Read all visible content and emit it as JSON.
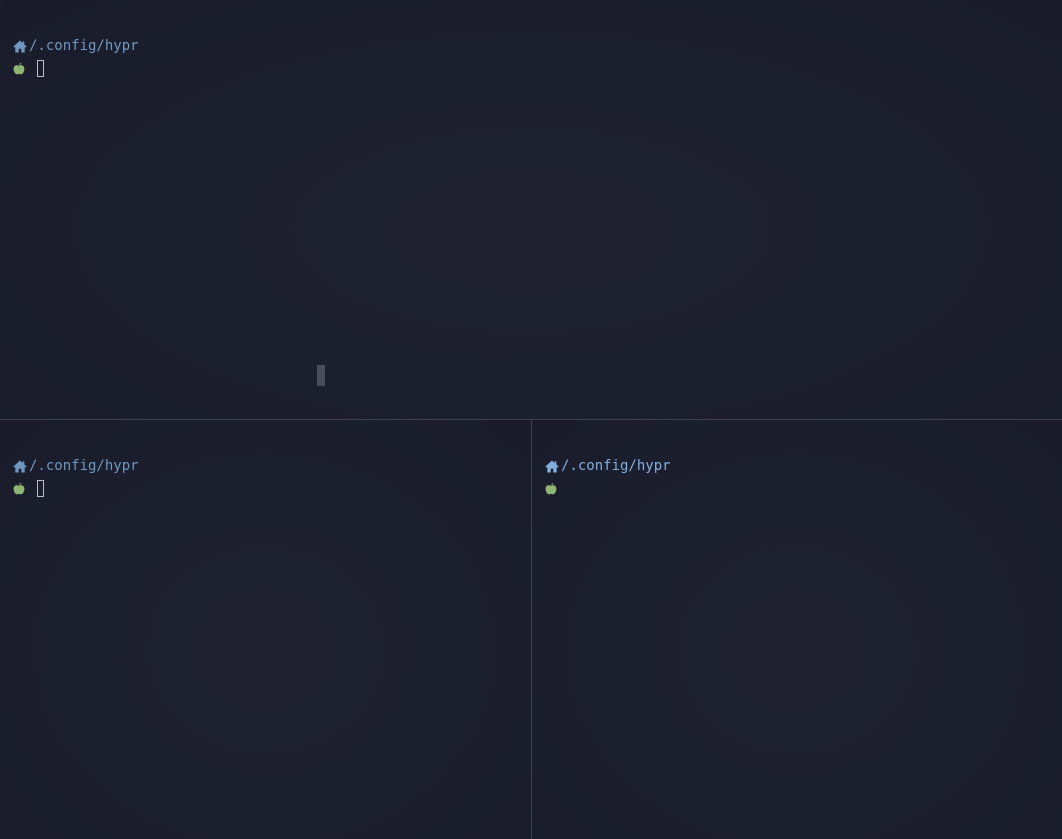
{
  "window": {
    "app": "terminal",
    "layout": "three panes: top, bottom-left, bottom-right"
  },
  "colors": {
    "background": "#1c1f2e",
    "path_text": "#6f98c0",
    "path_text_active": "#82aee0",
    "prompt_icon": "#8fb573",
    "divider": "#3a3f52",
    "cursor": "#b8bcc8"
  },
  "panes": {
    "top": {
      "path": "/.config/hypr",
      "home_icon": "home-icon",
      "prompt_icon": "apple-icon",
      "cursor_visible": true
    },
    "bottom_left": {
      "path": "/.config/hypr",
      "home_icon": "home-icon",
      "prompt_icon": "apple-icon",
      "cursor_visible": true
    },
    "bottom_right": {
      "path": "/.config/hypr",
      "home_icon": "home-icon",
      "prompt_icon": "apple-icon",
      "cursor_visible": false
    }
  }
}
